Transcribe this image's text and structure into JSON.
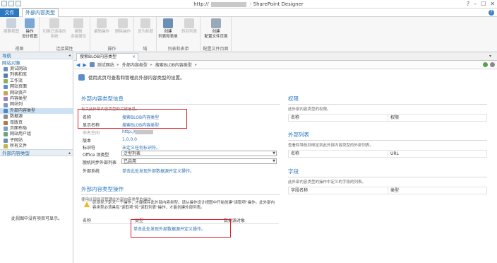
{
  "window": {
    "title_prefix": "http://",
    "title_suffix": " - SharePoint Designer",
    "controls": [
      "?",
      "–",
      "☐",
      "✕"
    ]
  },
  "ribbon_tabs": {
    "file": "文件",
    "active": "外部内容类型"
  },
  "ribbon": {
    "groups": [
      {
        "label": "视图",
        "buttons": [
          "摘要视图",
          "操作\n设计视图"
        ]
      },
      {
        "label": "连接属性",
        "buttons": [
          "切换已连接的\n系统",
          "编辑\n连接属性"
        ]
      },
      {
        "label": "操作",
        "buttons": [
          "编辑操作",
          "删除操作"
        ]
      },
      {
        "label": "域",
        "buttons": [
          "设为标题"
        ]
      },
      {
        "label": "列表和表单",
        "buttons": [
          "创建\n列表和表单",
          "转到列表"
        ]
      },
      {
        "label": "配置文件页面",
        "buttons": [
          "创建\n配置文件页面"
        ]
      }
    ]
  },
  "nav": {
    "header": "导航",
    "section": "网站对象",
    "items": [
      "测试网站",
      "列表和库",
      "工作流",
      "网站页面",
      "网站资产",
      "内容类型",
      "网站列",
      "外部内容类型",
      "数据源",
      "母版页",
      "页面布局",
      "网站用户组",
      "子网站",
      "所有文件"
    ],
    "selected_index": 7,
    "section2": "外部内容类型",
    "empty_text": "此视图中没有项目可显示。"
  },
  "doc_tab": {
    "label": "搜索BLOB内容类型",
    "close": "×"
  },
  "breadcrumb": [
    "测试网站",
    "外部内容类型",
    "搜索BLOB内容类型"
  ],
  "intro": "使用此页可查看和管理此外部内容类型的设置。",
  "info_panel": {
    "title": "外部内容类型信息",
    "desc": "有关此外部内容类型的关键信息。",
    "rows": [
      {
        "label": "名称",
        "value": "搜索BLOB内容类型"
      },
      {
        "label": "显示名称",
        "value": "搜索BLOB内容类型"
      },
      {
        "label": "命名空间",
        "value": "http://"
      },
      {
        "label": "版本",
        "value": "1.0.0.0"
      },
      {
        "label": "标识符",
        "value": "未定义任何标识符。"
      },
      {
        "label": "Office 项类型",
        "value": "泛型列表"
      },
      {
        "label": "脱机同步外部列表",
        "value": "已启用"
      },
      {
        "label": "外部系统",
        "value": "单击此处发现外部数据源并定义操作。"
      }
    ]
  },
  "ops_panel": {
    "title": "外部内容类型操作",
    "desc": "使用此部件可管理此外部内容类型的操作。",
    "warning": "必须至少定义一个操作，才能保存此外部内容类型。请从操作设计视图中开始创建\"读取项\"操作。此外部内容类型必须具有\"读取项\"和\"读取列表\"操作，才能创建外部列表。",
    "columns": [
      "名称",
      "类型",
      "数据源对象"
    ],
    "link": "单击此处发现外部数据源并定义操作。"
  },
  "perm_panel": {
    "title": "权限",
    "desc": "此外部内容类型的权限。",
    "cols": [
      "名称",
      "权限"
    ]
  },
  "extlist_panel": {
    "title": "外部列表",
    "desc": "查看和导航到绑定到此外部内容类型的外部列表。",
    "cols": [
      "名称",
      "URL"
    ]
  },
  "fields_panel": {
    "title": "字段",
    "desc": "此外部内容类型的操作中定义的字段的列表。",
    "cols": [
      "字段名称",
      "类型"
    ]
  }
}
